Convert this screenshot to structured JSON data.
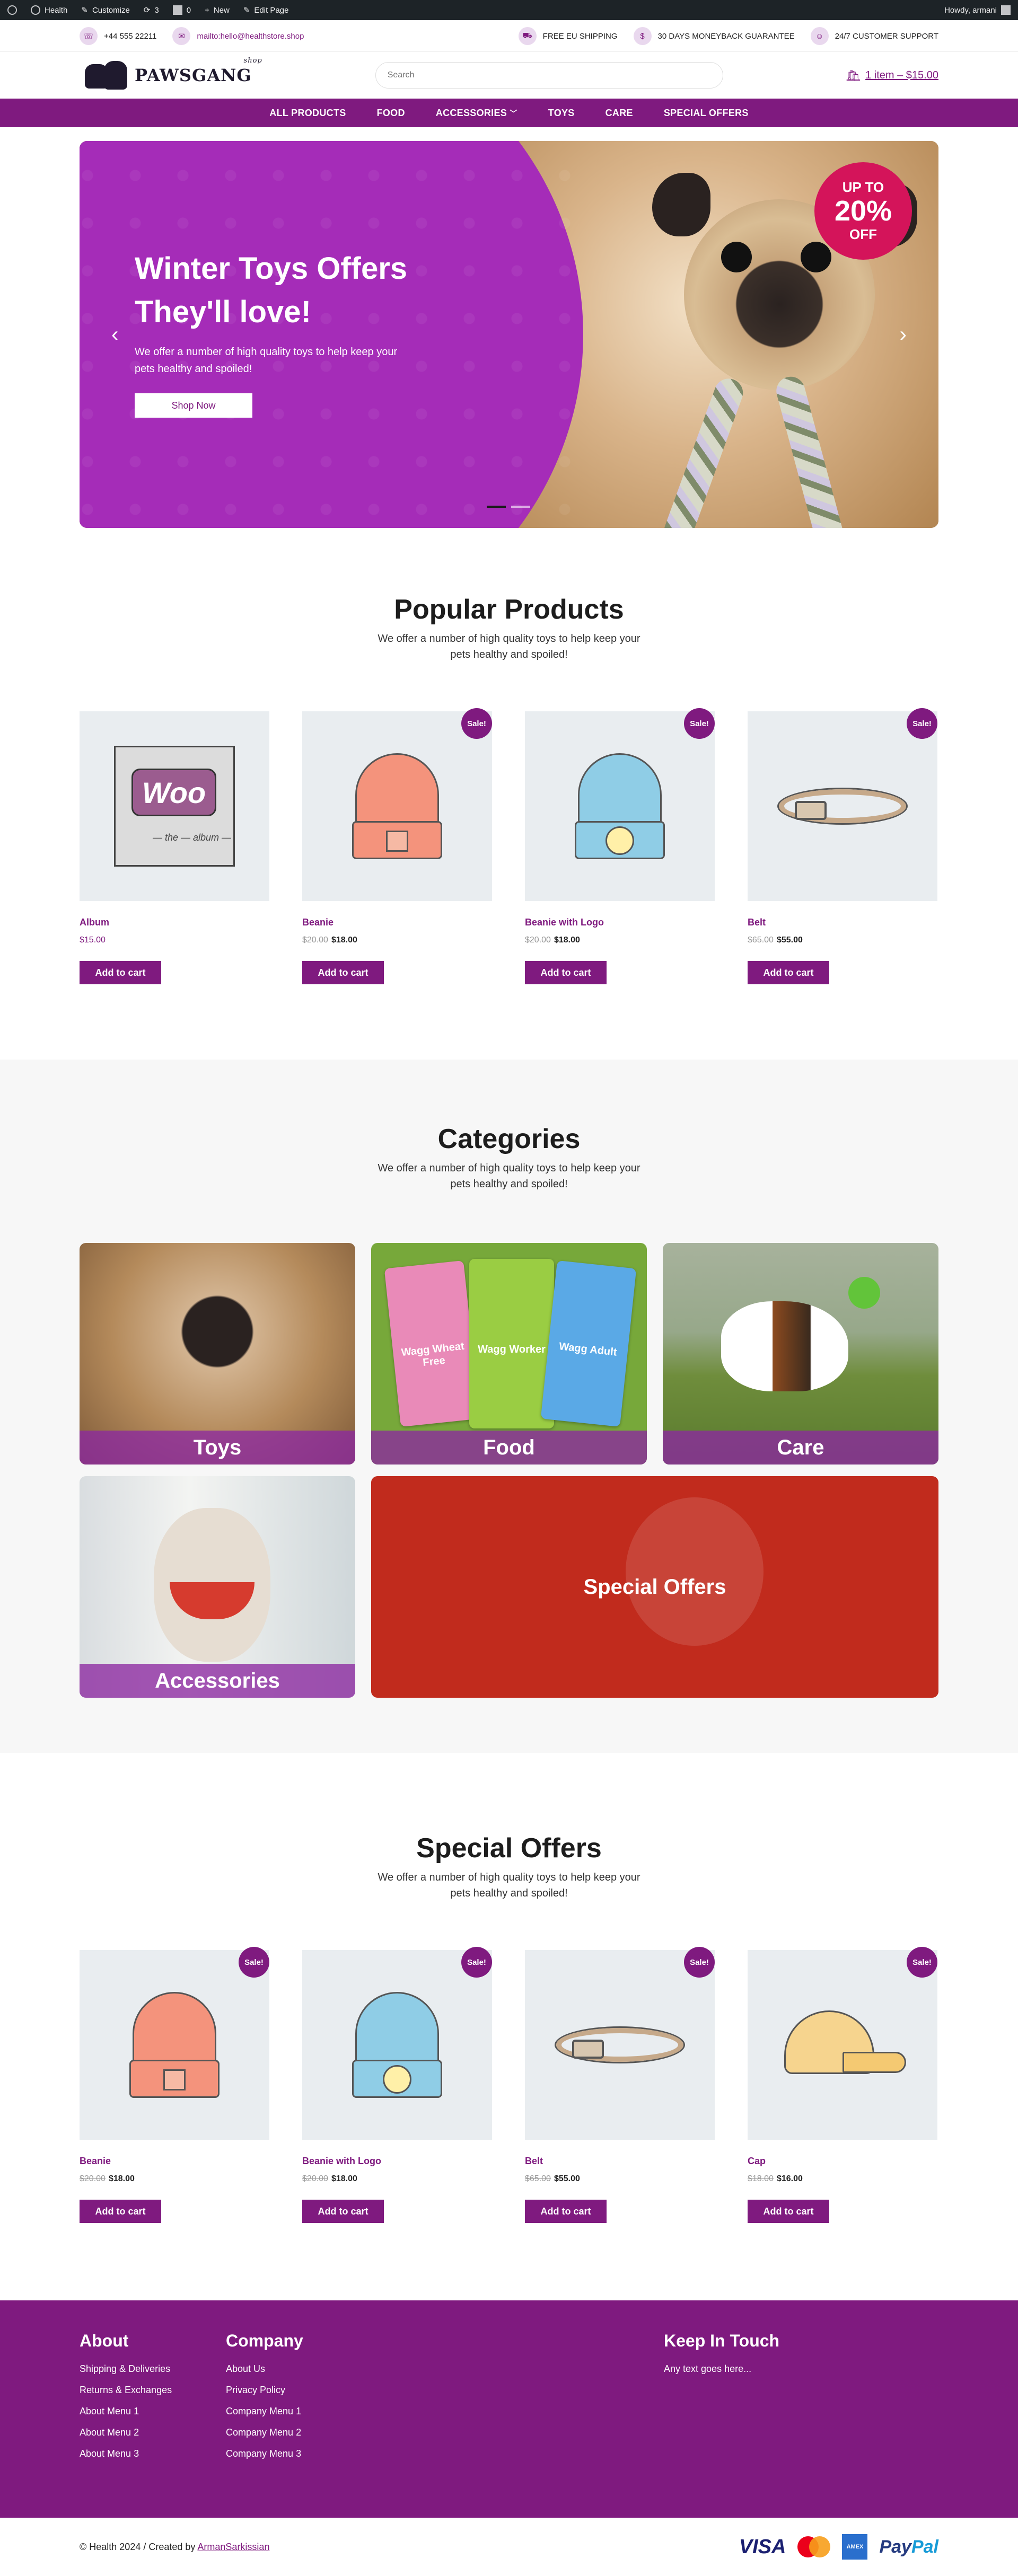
{
  "adminbar": {
    "site": "Health",
    "customize": "Customize",
    "updates": "3",
    "comments": "0",
    "new": "New",
    "edit_page": "Edit Page",
    "howdy": "Howdy, armani"
  },
  "infobar": {
    "phone": "+44 555 22211",
    "email": "mailto:hello@healthstore.shop",
    "shipping": "FREE EU SHIPPING",
    "moneyback": "30 DAYS MONEYBACK GUARANTEE",
    "support": "24/7 CUSTOMER SUPPORT"
  },
  "header": {
    "logo_text": "PAWSGANG",
    "logo_sub": "shop",
    "search_placeholder": "Search",
    "cart_label": "1 item – $15.00"
  },
  "nav": {
    "items": [
      "ALL PRODUCTS",
      "FOOD",
      "ACCESSORIES",
      "TOYS",
      "CARE",
      "SPECIAL OFFERS"
    ],
    "dropdown_caret": "﹀"
  },
  "hero": {
    "title_line1": "Winter Toys Offers",
    "title_line2": "They'll love!",
    "description": "We offer a number of high quality toys to help keep your pets healthy and spoiled!",
    "button": "Shop Now",
    "badge_line1": "UP TO",
    "badge_line2": "20%",
    "badge_line3": "OFF",
    "prev_arrow": "‹",
    "next_arrow": "›",
    "active_slide": 1,
    "slide_count": 2
  },
  "popular": {
    "title": "Popular Products",
    "subtitle": "We offer a number of high quality toys to help keep your pets healthy and spoiled!",
    "products": [
      {
        "name": "Album",
        "old_price": "",
        "price": "$15.00",
        "sale": false,
        "image": "woo-album"
      },
      {
        "name": "Beanie",
        "old_price": "$20.00",
        "price": "$18.00",
        "sale": true,
        "image": "beanie-orange"
      },
      {
        "name": "Beanie with Logo",
        "old_price": "$20.00",
        "price": "$18.00",
        "sale": true,
        "image": "beanie-blue"
      },
      {
        "name": "Belt",
        "old_price": "$65.00",
        "price": "$55.00",
        "sale": true,
        "image": "belt"
      }
    ],
    "sale_label": "Sale!",
    "cart_button": "Add to cart"
  },
  "categories": {
    "title": "Categories",
    "subtitle": "We offer a number of high quality toys to help keep your pets healthy and spoiled!",
    "items": [
      "Toys",
      "Food",
      "Care",
      "Accessories",
      "Special Offers"
    ],
    "food_bags": [
      "Wagg Wheat Free",
      "Wagg Worker",
      "Wagg Adult"
    ]
  },
  "special": {
    "title": "Special Offers",
    "subtitle": "We offer a number of high quality toys to help keep your pets healthy and spoiled!",
    "products": [
      {
        "name": "Beanie",
        "old_price": "$20.00",
        "price": "$18.00",
        "image": "beanie-orange"
      },
      {
        "name": "Beanie with Logo",
        "old_price": "$20.00",
        "price": "$18.00",
        "image": "beanie-blue"
      },
      {
        "name": "Belt",
        "old_price": "$65.00",
        "price": "$55.00",
        "image": "belt"
      },
      {
        "name": "Cap",
        "old_price": "$18.00",
        "price": "$16.00",
        "image": "cap"
      }
    ],
    "sale_label": "Sale!",
    "cart_button": "Add to cart"
  },
  "footer": {
    "about_title": "About",
    "about_links": [
      "Shipping & Deliveries",
      "Returns & Exchanges",
      "About Menu 1",
      "About Menu 2",
      "About Menu 3"
    ],
    "company_title": "Company",
    "company_links": [
      "About Us",
      "Privacy Policy",
      "Company Menu 1",
      "Company Menu 2",
      "Company Menu 3"
    ],
    "keep_title": "Keep In Touch",
    "keep_text": "Any text goes here...",
    "copyright": "© Health 2024 / Created by",
    "author": "ArmanSarkissian",
    "payments": {
      "visa": "VISA",
      "amex": "AMEX",
      "paypal_1": "Pay",
      "paypal_2": "Pal"
    }
  },
  "colors": {
    "brand_purple": "#7f1a7f",
    "hero_purple": "#a52cb8",
    "badge_red": "#d4145a",
    "special_red": "#c12b1d"
  }
}
